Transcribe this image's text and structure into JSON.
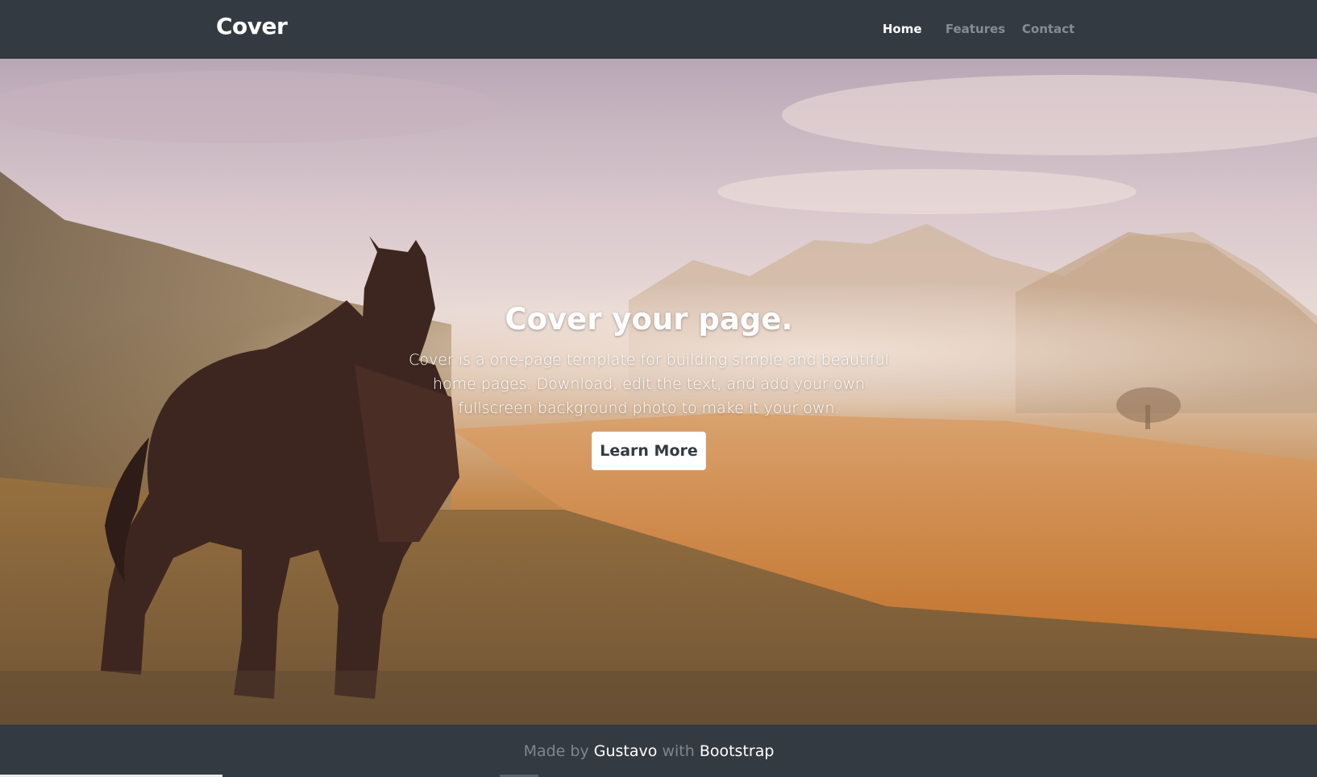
{
  "navbar": {
    "brand": "Cover",
    "links": [
      {
        "label": "Home",
        "active": true
      },
      {
        "label": "Features",
        "active": false
      },
      {
        "label": "Contact",
        "active": false
      }
    ]
  },
  "hero": {
    "title": "Cover your page.",
    "lead": "Cover is a one-page template for building simple and beautiful home pages. Download, edit the text, and add your own fullscreen background photo to make it your own.",
    "button_label": "Learn More",
    "background_image": "horse-in-field-photo"
  },
  "footer": {
    "made_by": "Made by",
    "author": "Gustavo",
    "with": "with",
    "framework": "Bootstrap"
  },
  "colors": {
    "nav_bg": "#333a42",
    "active_link": "#ffffff",
    "inactive_link": "#868c93",
    "button_bg": "#ffffff",
    "button_text": "#333a42"
  }
}
